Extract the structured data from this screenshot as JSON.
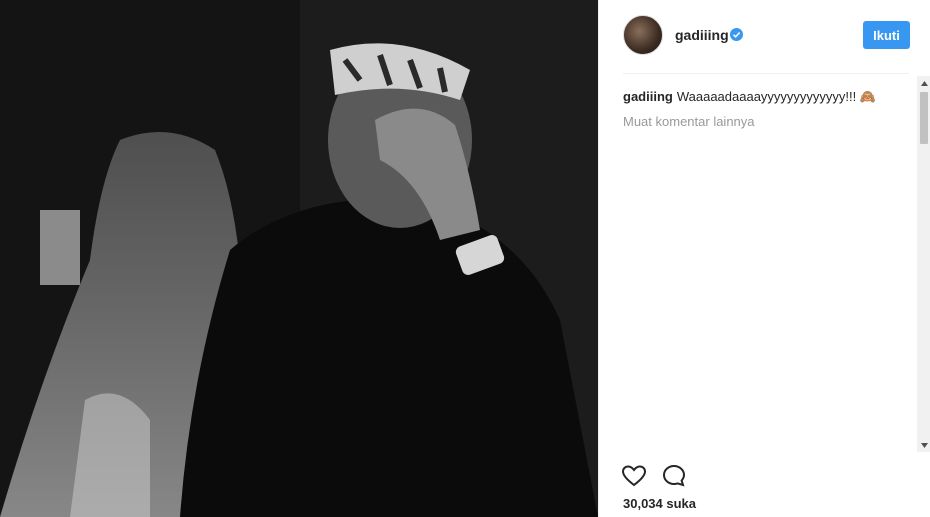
{
  "post": {
    "username": "gadiiing",
    "follow_label": "Ikuti",
    "caption_user": "gadiiing",
    "caption_text": "Waaaaadaaaayyyyyyyyyyyyy!!! 🙈",
    "load_more": "Muat komentar lainnya",
    "likes": "30,034 suka"
  },
  "icons": {
    "verified": "verified-badge-icon",
    "like": "heart-icon",
    "comment": "comment-bubble-icon"
  },
  "colors": {
    "accent": "#3897f0",
    "text": "#262626",
    "muted": "#999999"
  }
}
